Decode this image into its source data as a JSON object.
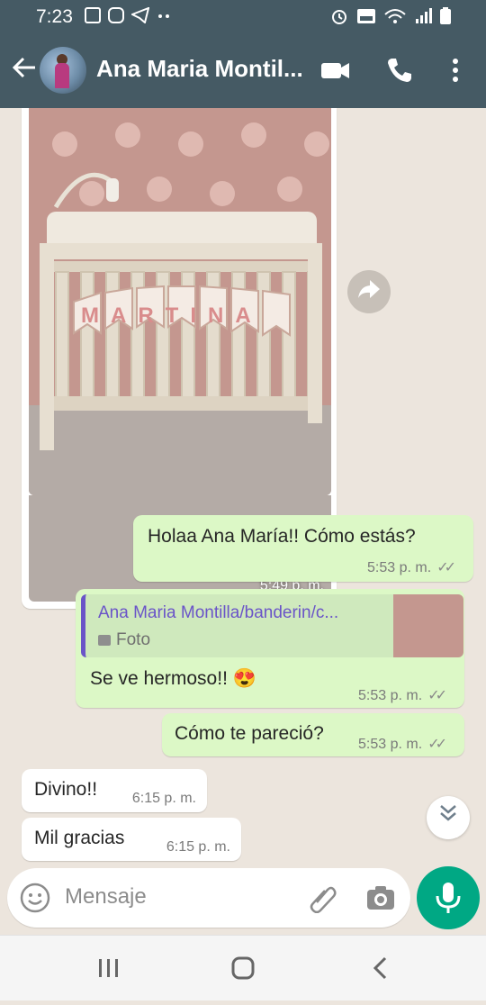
{
  "status_bar": {
    "time": "7:23"
  },
  "header": {
    "contact_name": "Ana Maria Montil..."
  },
  "photo_message": {
    "banner_text": "MARTINA",
    "time": "5:49 p. m."
  },
  "messages": [
    {
      "text": "Holaa Ana María!! Cómo estás?",
      "time": "5:53 p. m."
    },
    {
      "quote_author": "Ana Maria Montilla/banderin/c...",
      "quote_type": "Foto",
      "text": "Se ve hermoso!! 😍",
      "time": "5:53 p. m."
    },
    {
      "text": "Cómo te pareció?",
      "time": "5:53 p. m."
    },
    {
      "text": "Divino!!",
      "time": "6:15 p. m."
    },
    {
      "text": "Mil gracias",
      "time": "6:15 p. m."
    }
  ],
  "composer": {
    "placeholder": "Mensaje"
  },
  "colors": {
    "header": "#455a64",
    "outgoing": "#dcf8c6",
    "incoming": "#ffffff",
    "accent": "#00a884",
    "quote_author": "#6a54c8"
  }
}
